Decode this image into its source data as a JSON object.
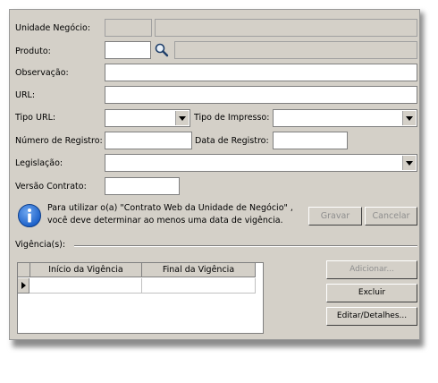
{
  "labels": {
    "unidade_negocio": "Unidade Negócio:",
    "produto": "Produto:",
    "observacao": "Observação:",
    "url": "URL:",
    "tipo_url": "Tipo URL:",
    "tipo_impresso": "Tipo de Impresso:",
    "numero_registro": "Número de Registro:",
    "data_registro": "Data de Registro:",
    "legislacao": "Legislação:",
    "versao_contrato": "Versão Contrato:",
    "vigencias": "Vigência(s):"
  },
  "fields": {
    "unidade_codigo": "",
    "unidade_nome": "",
    "produto_codigo": "",
    "produto_nome": "",
    "observacao": "",
    "url": "",
    "tipo_url": "",
    "tipo_impresso": "",
    "numero_registro": "",
    "data_registro": "",
    "legislacao": "",
    "versao_contrato": ""
  },
  "info": {
    "icon": "info-icon",
    "line1": "Para utilizar o(a) \"Contrato Web da Unidade de Negócio\" ,",
    "line2": "você deve determinar ao menos uma data de vigência."
  },
  "buttons": {
    "gravar": "Gravar",
    "cancelar": "Cancelar",
    "adicionar": "Adicionar...",
    "excluir": "Excluir",
    "editar": "Editar/Detalhes..."
  },
  "grid": {
    "columns": [
      "Início da Vigência",
      "Final da Vigência"
    ]
  },
  "colors": {
    "form_bg": "#d4d0c8",
    "info_blue": "#1a5fc8"
  }
}
